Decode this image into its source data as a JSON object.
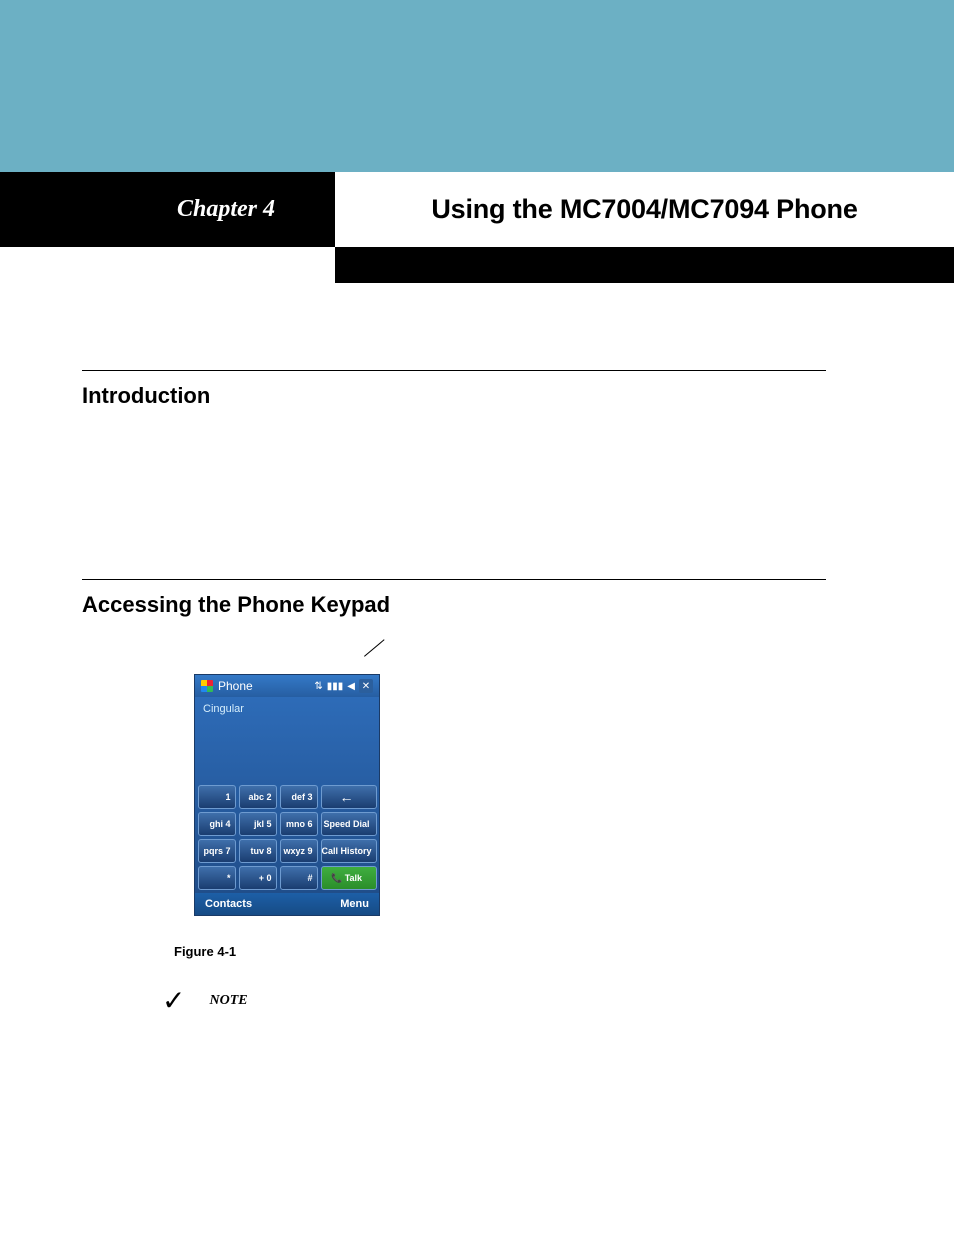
{
  "chapter_label": "Chapter 4",
  "page_title": "Using the MC7004/MC7094 Phone",
  "sections": {
    "introduction": {
      "title": "Introduction"
    },
    "accessing": {
      "title": "Accessing the Phone Keypad"
    }
  },
  "figure": {
    "caption": "Figure 4-1",
    "statusbar": {
      "app": "Phone",
      "icons": [
        "sync-icon",
        "signal-icon",
        "speaker-icon",
        "close-x"
      ]
    },
    "carrier": "Cingular",
    "keypad": {
      "rows": [
        [
          "1",
          "abc 2",
          "def 3"
        ],
        [
          "ghi 4",
          "jkl 5",
          "mno 6"
        ],
        [
          "pqrs 7",
          "tuv 8",
          "wxyz 9"
        ],
        [
          "*",
          "+ 0",
          "#"
        ]
      ],
      "side": [
        "←",
        "Speed Dial",
        "Call History",
        "Talk"
      ]
    },
    "softkeys": {
      "left": "Contacts",
      "right": "Menu"
    }
  },
  "note": {
    "label": "NOTE",
    "check": "✓"
  }
}
